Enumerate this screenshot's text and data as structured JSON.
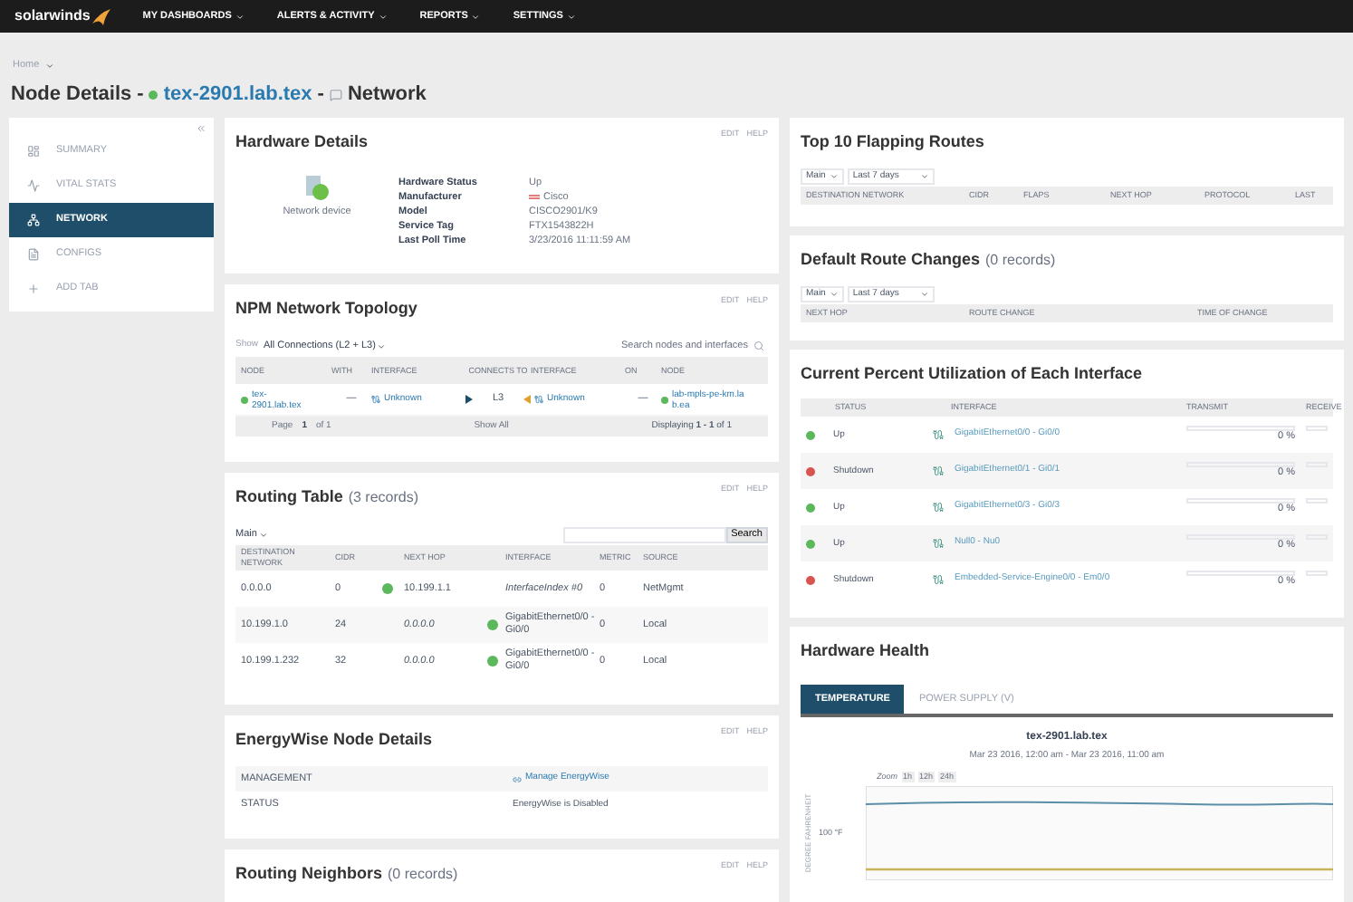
{
  "nav": {
    "logo": "solarwinds",
    "menus": [
      "MY DASHBOARDS",
      "ALERTS & ACTIVITY",
      "REPORTS",
      "SETTINGS"
    ]
  },
  "breadcrumb": [
    "Home"
  ],
  "page_title": {
    "prefix": "Node Details -",
    "node": "tex-2901.lab.tex",
    "separator": "-",
    "view": "Network"
  },
  "sidebar": {
    "items": [
      {
        "label": "SUMMARY",
        "selected": false
      },
      {
        "label": "VITAL STATS",
        "selected": false
      },
      {
        "label": "NETWORK",
        "selected": true
      },
      {
        "label": "CONFIGS",
        "selected": false
      },
      {
        "label": "ADD TAB",
        "selected": false
      }
    ]
  },
  "hardware_details": {
    "title": "Hardware Details",
    "links": [
      "EDIT",
      "HELP"
    ],
    "device_label": "Network device",
    "fields": [
      {
        "label": "Hardware Status",
        "value": "Up",
        "kind": "text"
      },
      {
        "label": "Manufacturer",
        "value": "Cisco",
        "kind": "vendor"
      },
      {
        "label": "Model",
        "value": "CISCO2901/K9",
        "kind": "text"
      },
      {
        "label": "Service Tag",
        "value": "FTX1543822H",
        "kind": "text"
      },
      {
        "label": "Last Poll Time",
        "value": "3/23/2016 11:11:59 AM",
        "kind": "text"
      }
    ]
  },
  "topology": {
    "title": "NPM Network Topology",
    "links": [
      "EDIT",
      "HELP"
    ],
    "show_label": "Show",
    "filter": "All Connections (L2 + L3)",
    "search_placeholder": "Search nodes and interfaces",
    "columns": [
      "NODE",
      "WITH",
      "INTERFACE",
      "CONNECTS TO",
      "INTERFACE",
      "ON",
      "NODE"
    ],
    "rows": [
      {
        "node": "tex-2901.lab.tex",
        "with": "—",
        "interface": "Unknown",
        "connects_to": "L3",
        "interface_2": "Unknown",
        "on": "—",
        "node_2": "lab-mpls-pe-km.lab.ea"
      }
    ],
    "pager": {
      "page_label": "Page",
      "page": "1",
      "of": "of 1",
      "show_all": "Show All",
      "displaying": "Displaying **1 - 1** of 1"
    }
  },
  "routing_table": {
    "title": "Routing Table",
    "count": "(3 records)",
    "links": [
      "EDIT",
      "HELP"
    ],
    "vrf": "Main",
    "search_button": "Search",
    "columns": [
      "DESTINATION NETWORK",
      "CIDR",
      "NEXT HOP",
      "INTERFACE",
      "METRIC",
      "SOURCE"
    ],
    "rows": [
      {
        "destination": "0.0.0.0",
        "cidr": "0",
        "next_hop_up": true,
        "next_hop": "10.199.1.1",
        "interface_up": false,
        "interface": "InterfaceIndex #0",
        "metric": "0",
        "source": "NetMgmt"
      },
      {
        "destination": "10.199.1.0",
        "cidr": "24",
        "next_hop_up": false,
        "next_hop": "0.0.0.0",
        "interface_up": true,
        "interface": "GigabitEthernet0/0 - Gi0/0",
        "metric": "0",
        "source": "Local"
      },
      {
        "destination": "10.199.1.232",
        "cidr": "32",
        "next_hop_up": false,
        "next_hop": "0.0.0.0",
        "interface_up": true,
        "interface": "GigabitEthernet0/0 - Gi0/0",
        "metric": "0",
        "source": "Local"
      }
    ]
  },
  "energywise": {
    "title": "EnergyWise Node Details",
    "links": [
      "EDIT",
      "HELP"
    ],
    "rows": [
      {
        "label": "MANAGEMENT",
        "value": "Manage EnergyWise",
        "kind": "link"
      },
      {
        "label": "STATUS",
        "value": "EnergyWise is Disabled",
        "kind": "text"
      }
    ]
  },
  "routing_neighbors": {
    "title": "Routing Neighbors",
    "count": "(0 records)",
    "links": [
      "EDIT",
      "HELP"
    ]
  },
  "flapping_routes": {
    "title": "Top 10 Flapping Routes",
    "vrf": "Main",
    "period": "Last 7 days",
    "columns": [
      "DESTINATION NETWORK",
      "CIDR",
      "FLAPS",
      "NEXT HOP",
      "PROTOCOL",
      "LAST"
    ]
  },
  "default_route_changes": {
    "title": "Default Route Changes",
    "count": "(0 records)",
    "vrf": "Main",
    "period": "Last 7 days",
    "columns": [
      "NEXT HOP",
      "ROUTE CHANGE",
      "TIME OF CHANGE"
    ]
  },
  "utilization": {
    "title": "Current Percent Utilization of Each Interface",
    "columns": [
      "STATUS",
      "INTERFACE",
      "TRANSMIT",
      "RECEIVE"
    ],
    "rows": [
      {
        "status": "Up",
        "color": "#5cb85c",
        "interface": "GigabitEthernet0/0 - Gi0/0",
        "transmit": {
          "level": 0,
          "reading": "0 %"
        },
        "receive": {
          "level": 0
        }
      },
      {
        "status": "Shutdown",
        "color": "#d9534f",
        "interface": "GigabitEthernet0/1 - Gi0/1",
        "transmit": {
          "level": 0,
          "reading": "0 %"
        },
        "receive": {
          "level": 0
        }
      },
      {
        "status": "Up",
        "color": "#5cb85c",
        "interface": "GigabitEthernet0/3 - Gi0/3",
        "transmit": {
          "level": 0,
          "reading": "0 %"
        },
        "receive": {
          "level": 0
        }
      },
      {
        "status": "Up",
        "color": "#5cb85c",
        "interface": "Null0 - Nu0",
        "transmit": {
          "level": 0,
          "reading": "0 %"
        },
        "receive": {
          "level": 0
        }
      },
      {
        "status": "Shutdown",
        "color": "#d9534f",
        "interface": "Embedded-Service-Engine0/0 - Em0/0",
        "transmit": {
          "level": 0,
          "reading": "0 %"
        },
        "receive": {
          "level": 0
        }
      }
    ]
  },
  "hardware_health": {
    "title": "Hardware Health",
    "tabs": [
      {
        "label": "TEMPERATURE",
        "selected": true
      },
      {
        "label": "POWER SUPPLY (V)",
        "selected": false
      }
    ],
    "chart": {
      "title": "tex-2901.lab.tex",
      "subtitle": "Mar 23 2016, 12:00 am - Mar 23 2016, 11:00 am",
      "zoom_label": "Zoom",
      "zoom_options": [
        "1h",
        "12h",
        "24h"
      ],
      "y_axis_label": "DEGREE FAHRENHEIT",
      "y_tick": "100 °F"
    }
  }
}
